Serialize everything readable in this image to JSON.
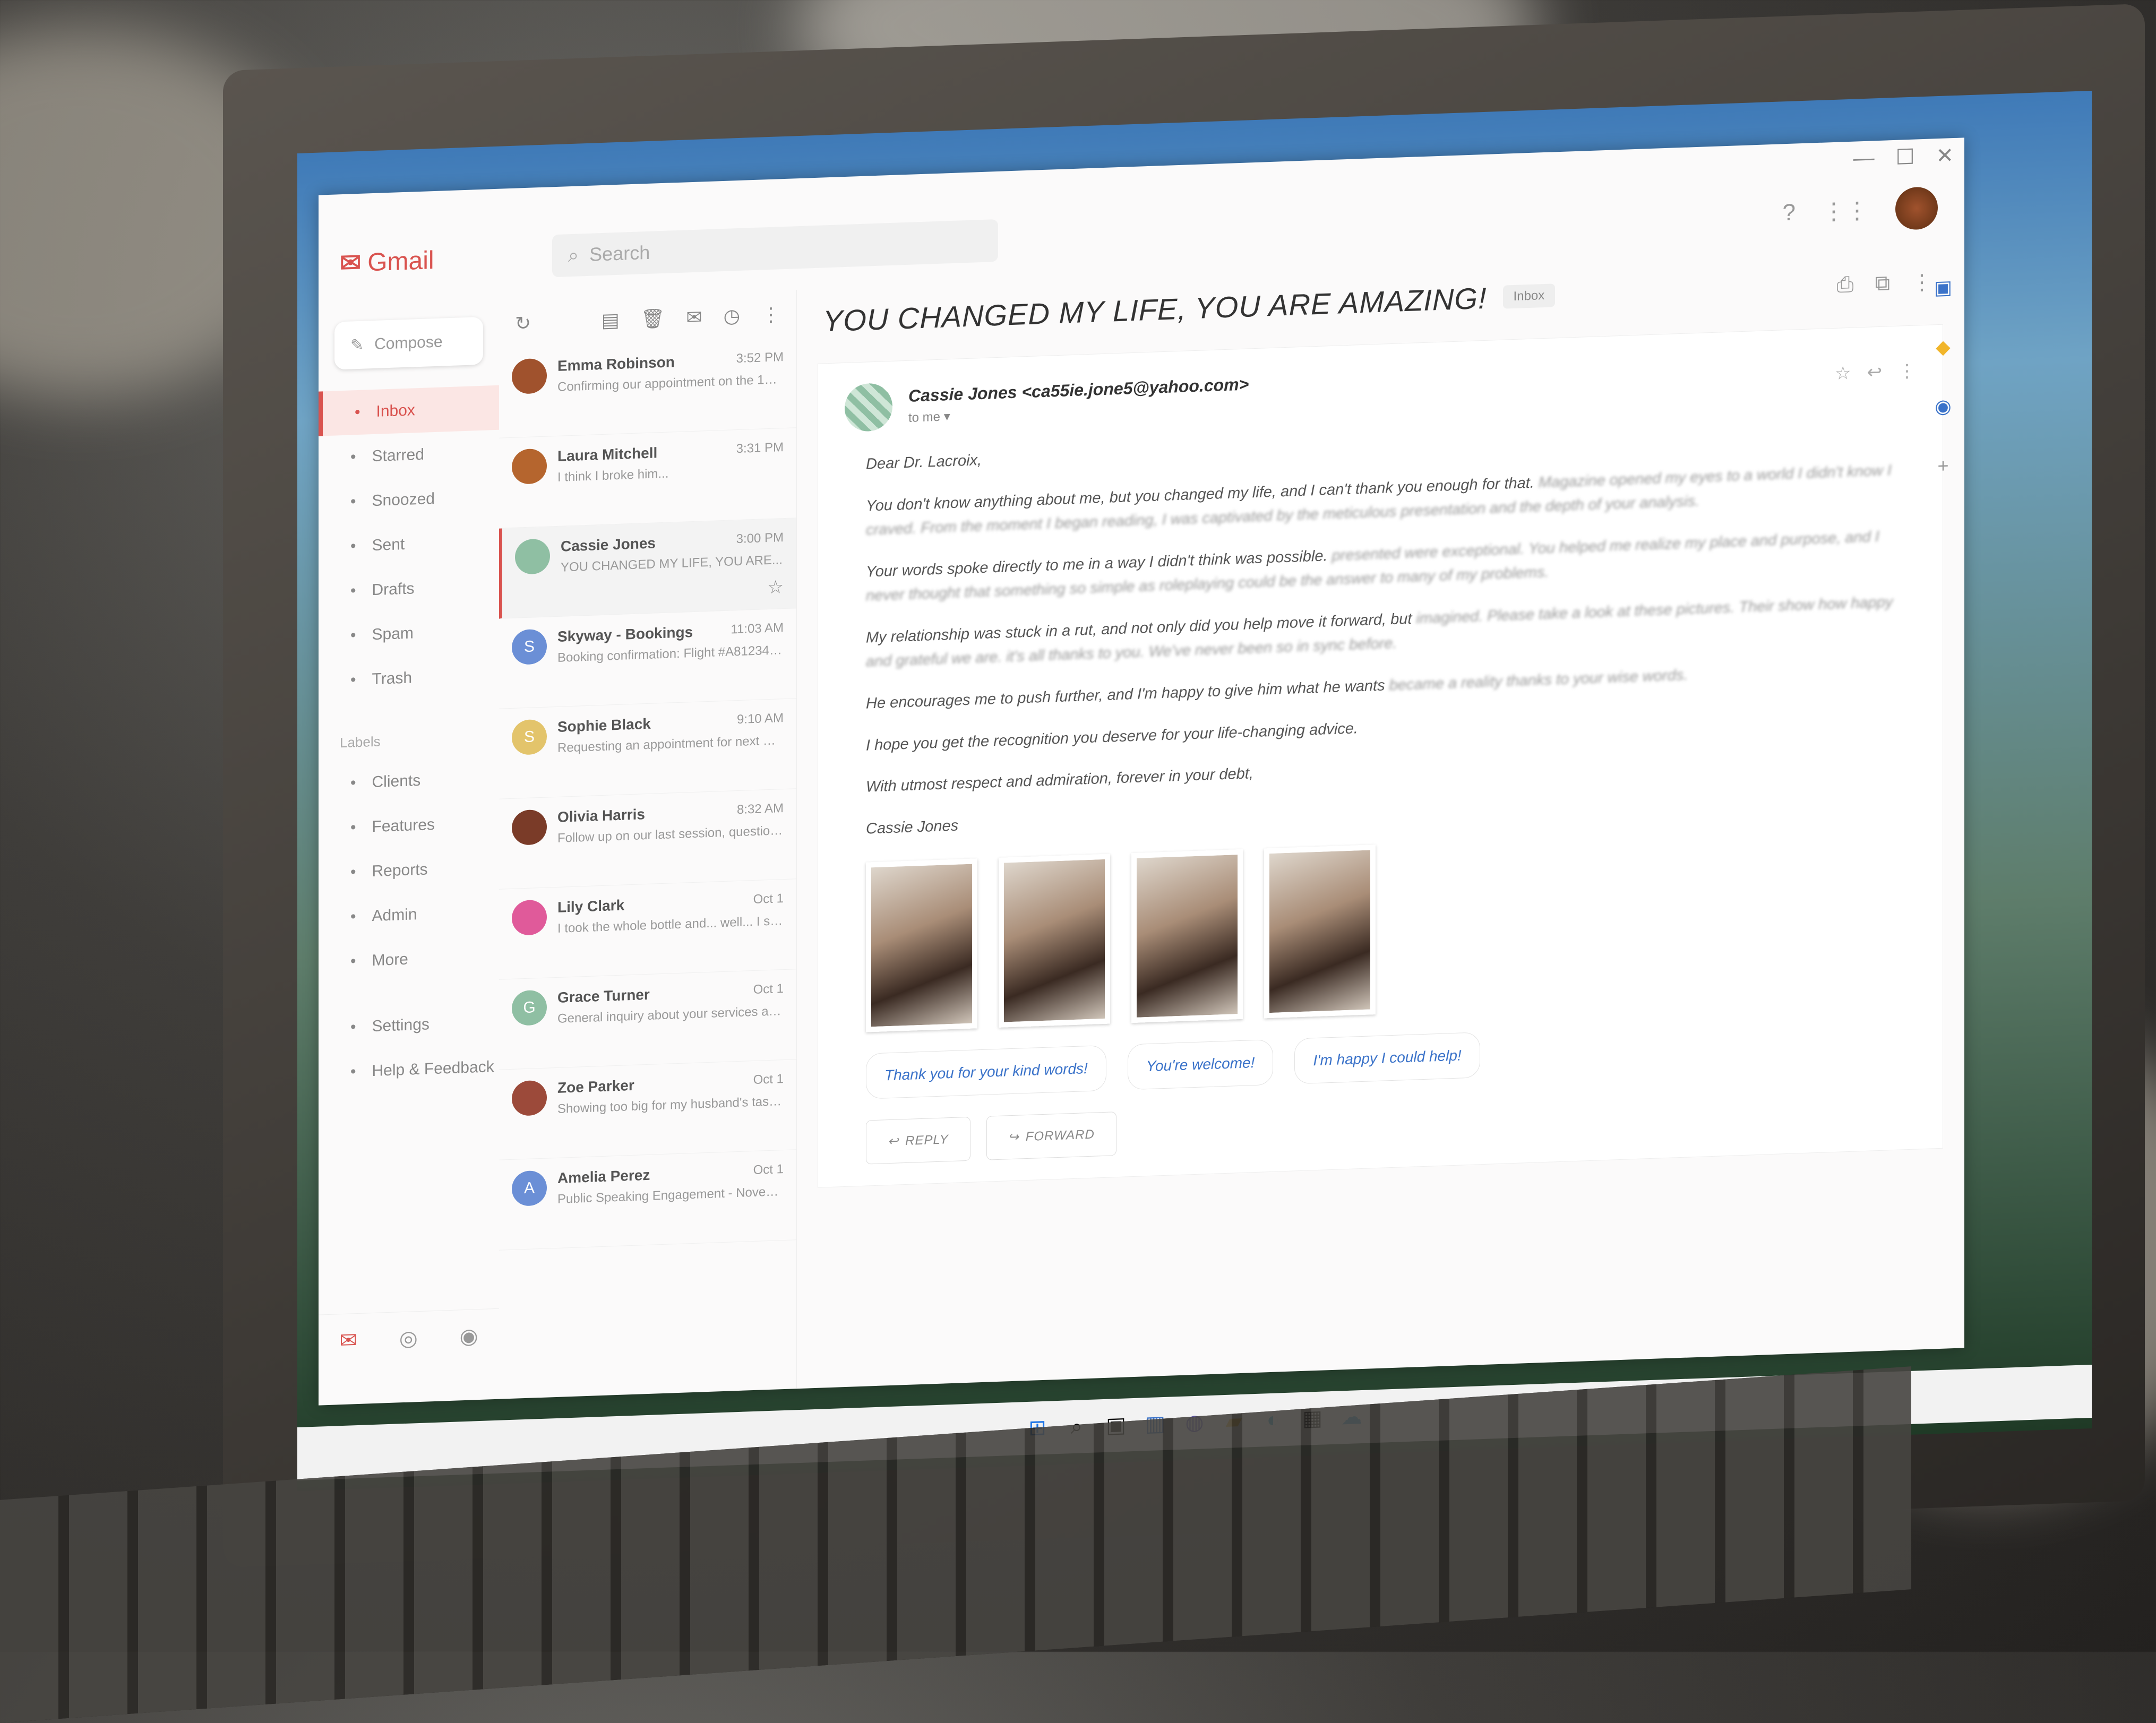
{
  "app": {
    "name": "Gmail",
    "search_placeholder": "Search"
  },
  "window_controls": [
    "—",
    "☐",
    "✕"
  ],
  "sidebar": {
    "compose_label": "Compose",
    "items": [
      {
        "label": "Inbox",
        "icon": "inbox-icon",
        "active": true
      },
      {
        "label": "Starred",
        "icon": "star-icon"
      },
      {
        "label": "Snoozed",
        "icon": "clock-icon"
      },
      {
        "label": "Sent",
        "icon": "send-icon"
      },
      {
        "label": "Drafts",
        "icon": "draft-icon"
      },
      {
        "label": "Spam",
        "icon": "spam-icon"
      },
      {
        "label": "Trash",
        "icon": "trash-icon"
      }
    ],
    "labels_heading": "Labels",
    "labels": [
      {
        "label": "Clients"
      },
      {
        "label": "Features"
      },
      {
        "label": "Reports"
      },
      {
        "label": "Admin"
      },
      {
        "label": "More"
      }
    ],
    "footer_items": [
      {
        "label": "Settings"
      },
      {
        "label": "Help & Feedback"
      }
    ]
  },
  "messages": [
    {
      "sender": "Emma Robinson",
      "time": "3:52 PM",
      "snippet": "Confirming our appointment on the 15th...",
      "avatar_color": "#a0522d"
    },
    {
      "sender": "Laura Mitchell",
      "time": "3:31 PM",
      "snippet": "I think I broke him...",
      "avatar_color": "#b5652e"
    },
    {
      "sender": "Cassie Jones",
      "time": "3:00 PM",
      "snippet": "YOU CHANGED MY LIFE, YOU ARE...",
      "avatar_color": "#8fbfa3",
      "selected": true
    },
    {
      "sender": "Skyway - Bookings",
      "time": "11:03 AM",
      "snippet": "Booking confirmation: Flight #A81234 on Sk...",
      "avatar_color": "#6b8fd6",
      "initial": "S"
    },
    {
      "sender": "Sophie Black",
      "time": "9:10 AM",
      "snippet": "Requesting an appointment for next week...",
      "avatar_color": "#e3c46b",
      "initial": "S"
    },
    {
      "sender": "Olivia Harris",
      "time": "8:32 AM",
      "snippet": "Follow up on our last session, question...",
      "avatar_color": "#7a3b28"
    },
    {
      "sender": "Lily Clark",
      "time": "Oct 1",
      "snippet": "I took the whole bottle and... well... I started to...",
      "avatar_color": "#e05a9a"
    },
    {
      "sender": "Grace Turner",
      "time": "Oct 1",
      "snippet": "General inquiry about your services and...",
      "avatar_color": "#8fbfa3",
      "initial": "G"
    },
    {
      "sender": "Zoe Parker",
      "time": "Oct 1",
      "snippet": "Showing too big for my husband's taste...",
      "avatar_color": "#9c4a3a"
    },
    {
      "sender": "Amelia Perez",
      "time": "Oct 1",
      "snippet": "Public Speaking Engagement - November",
      "avatar_color": "#6b8fd6",
      "initial": "A"
    }
  ],
  "email": {
    "subject": "YOU CHANGED MY LIFE, YOU ARE AMAZING!",
    "label_chip": "Inbox",
    "from": "Cassie Jones <ca55ie.jone5@yahoo.com>",
    "to": "to me",
    "greeting": "Dear Dr. Lacroix,",
    "p1_visible": "You don't know anything about me, but you changed my life, and I can't thank you enough for that.",
    "p1_cont": "Magazine opened my eyes to a world I didn't know I craved. From the moment I began reading, I was captivated by the meticulous presentation and the depth of your analysis.",
    "p2_visible": "Your words spoke directly to me in a way I didn't think was possible.",
    "p2_cont": "presented were exceptional. You helped me realize my place and purpose, and I never thought that something so simple as roleplaying could be the answer to many of my problems.",
    "p3_visible": "My relationship was stuck in a rut, and not only did you help move it forward, but",
    "p3_cont": "imagined. Please take a look at these pictures. Their show how happy and grateful we are. it's all thanks to you. We've never been so in sync before.",
    "p4_visible": "He encourages me to push further, and I'm happy to give him what he wants",
    "p4_cont": "became a reality thanks to your wise words.",
    "p5": "I hope you get the recognition you deserve for your life-changing advice.",
    "closing": "With utmost respect and admiration, forever in your debt,",
    "signature": "Cassie Jones",
    "photo_count": 4,
    "quick_replies": [
      "Thank you for your kind words!",
      "You're welcome!",
      "I'm happy I could help!"
    ],
    "reply_label": "REPLY",
    "forward_label": "FORWARD"
  },
  "taskbar_icons": [
    "windows-logo-icon",
    "search-icon",
    "task-view-icon",
    "widgets-icon",
    "chat-icon",
    "file-explorer-icon",
    "edge-icon",
    "store-icon",
    "weather-icon"
  ]
}
